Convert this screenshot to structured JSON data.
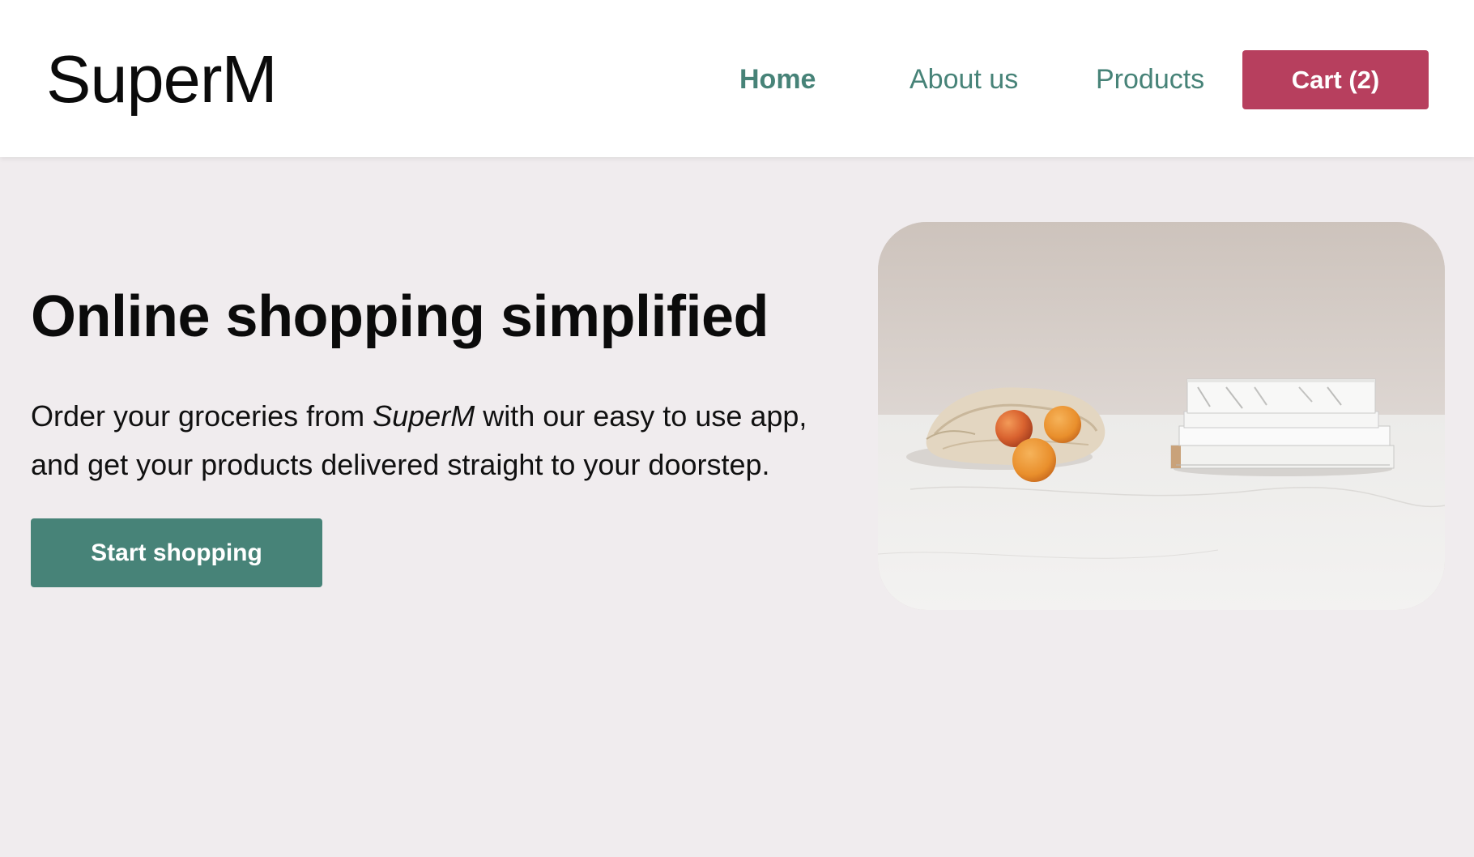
{
  "brand": "SuperM",
  "nav": {
    "home": "Home",
    "about": "About us",
    "products": "Products",
    "cart": "Cart (2)"
  },
  "hero": {
    "title": "Online shopping simplified",
    "text_before": "Order your groceries from ",
    "text_emphasis": "SuperM",
    "text_after": " with our easy to use app, and get your products delivered straight to your doorstep.",
    "cta": "Start shopping",
    "image_subject": "peaches-in-mesh-bag-and-books-on-marble"
  },
  "colors": {
    "accent_green": "#478378",
    "cart_red": "#b73f5e",
    "page_background": "#f0ecee",
    "navbar_background": "#ffffff"
  }
}
